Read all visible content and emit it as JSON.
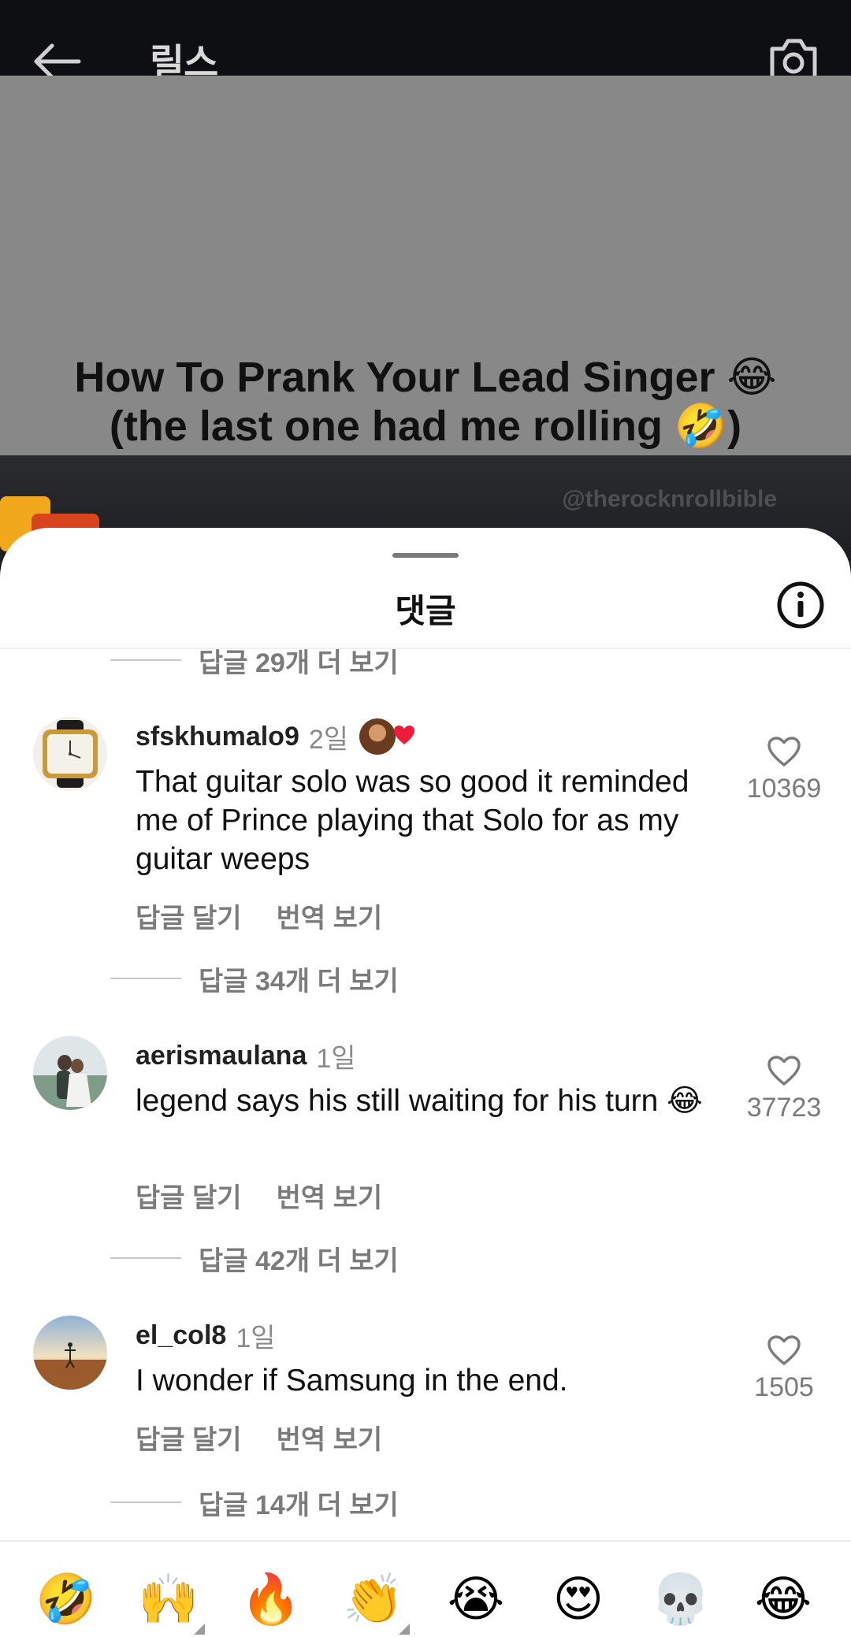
{
  "header": {
    "title": "릴스"
  },
  "video": {
    "caption_line1": "How To Prank Your Lead Singer 😂",
    "caption_line2": "(the last one had me rolling 🤣)",
    "watermark": "@therocknrollbible"
  },
  "sheet": {
    "title": "댓글"
  },
  "top_more_replies": "답글 29개 더 보기",
  "comments": [
    {
      "username": "sfskhumalo9",
      "time": "2일",
      "text": "That guitar solo was so good it reminded me of Prince playing that Solo for as my guitar weeps",
      "reply_label": "답글 달기",
      "translate_label": "번역 보기",
      "likes": "10369",
      "more_replies": "답글 34개 더 보기"
    },
    {
      "username": "aerismaulana",
      "time": "1일",
      "text": "legend says his still waiting for his turn 😂",
      "reply_label": "답글 달기",
      "translate_label": "번역 보기",
      "likes": "37723",
      "more_replies": "답글 42개 더 보기"
    },
    {
      "username": "el_col8",
      "time": "1일",
      "text": "I wonder if Samsung in the end.",
      "reply_label": "답글 달기",
      "translate_label": "번역 보기",
      "likes": "1505",
      "more_replies": "답글 14개 더 보기"
    }
  ],
  "emoji_bar": [
    "🤣",
    "🙌",
    "🔥",
    "👏",
    "😭",
    "😍",
    "💀",
    "😂"
  ],
  "icons": {
    "back": "back-arrow-icon",
    "camera": "camera-icon",
    "info": "info-icon",
    "like": "heart-outline-icon"
  }
}
